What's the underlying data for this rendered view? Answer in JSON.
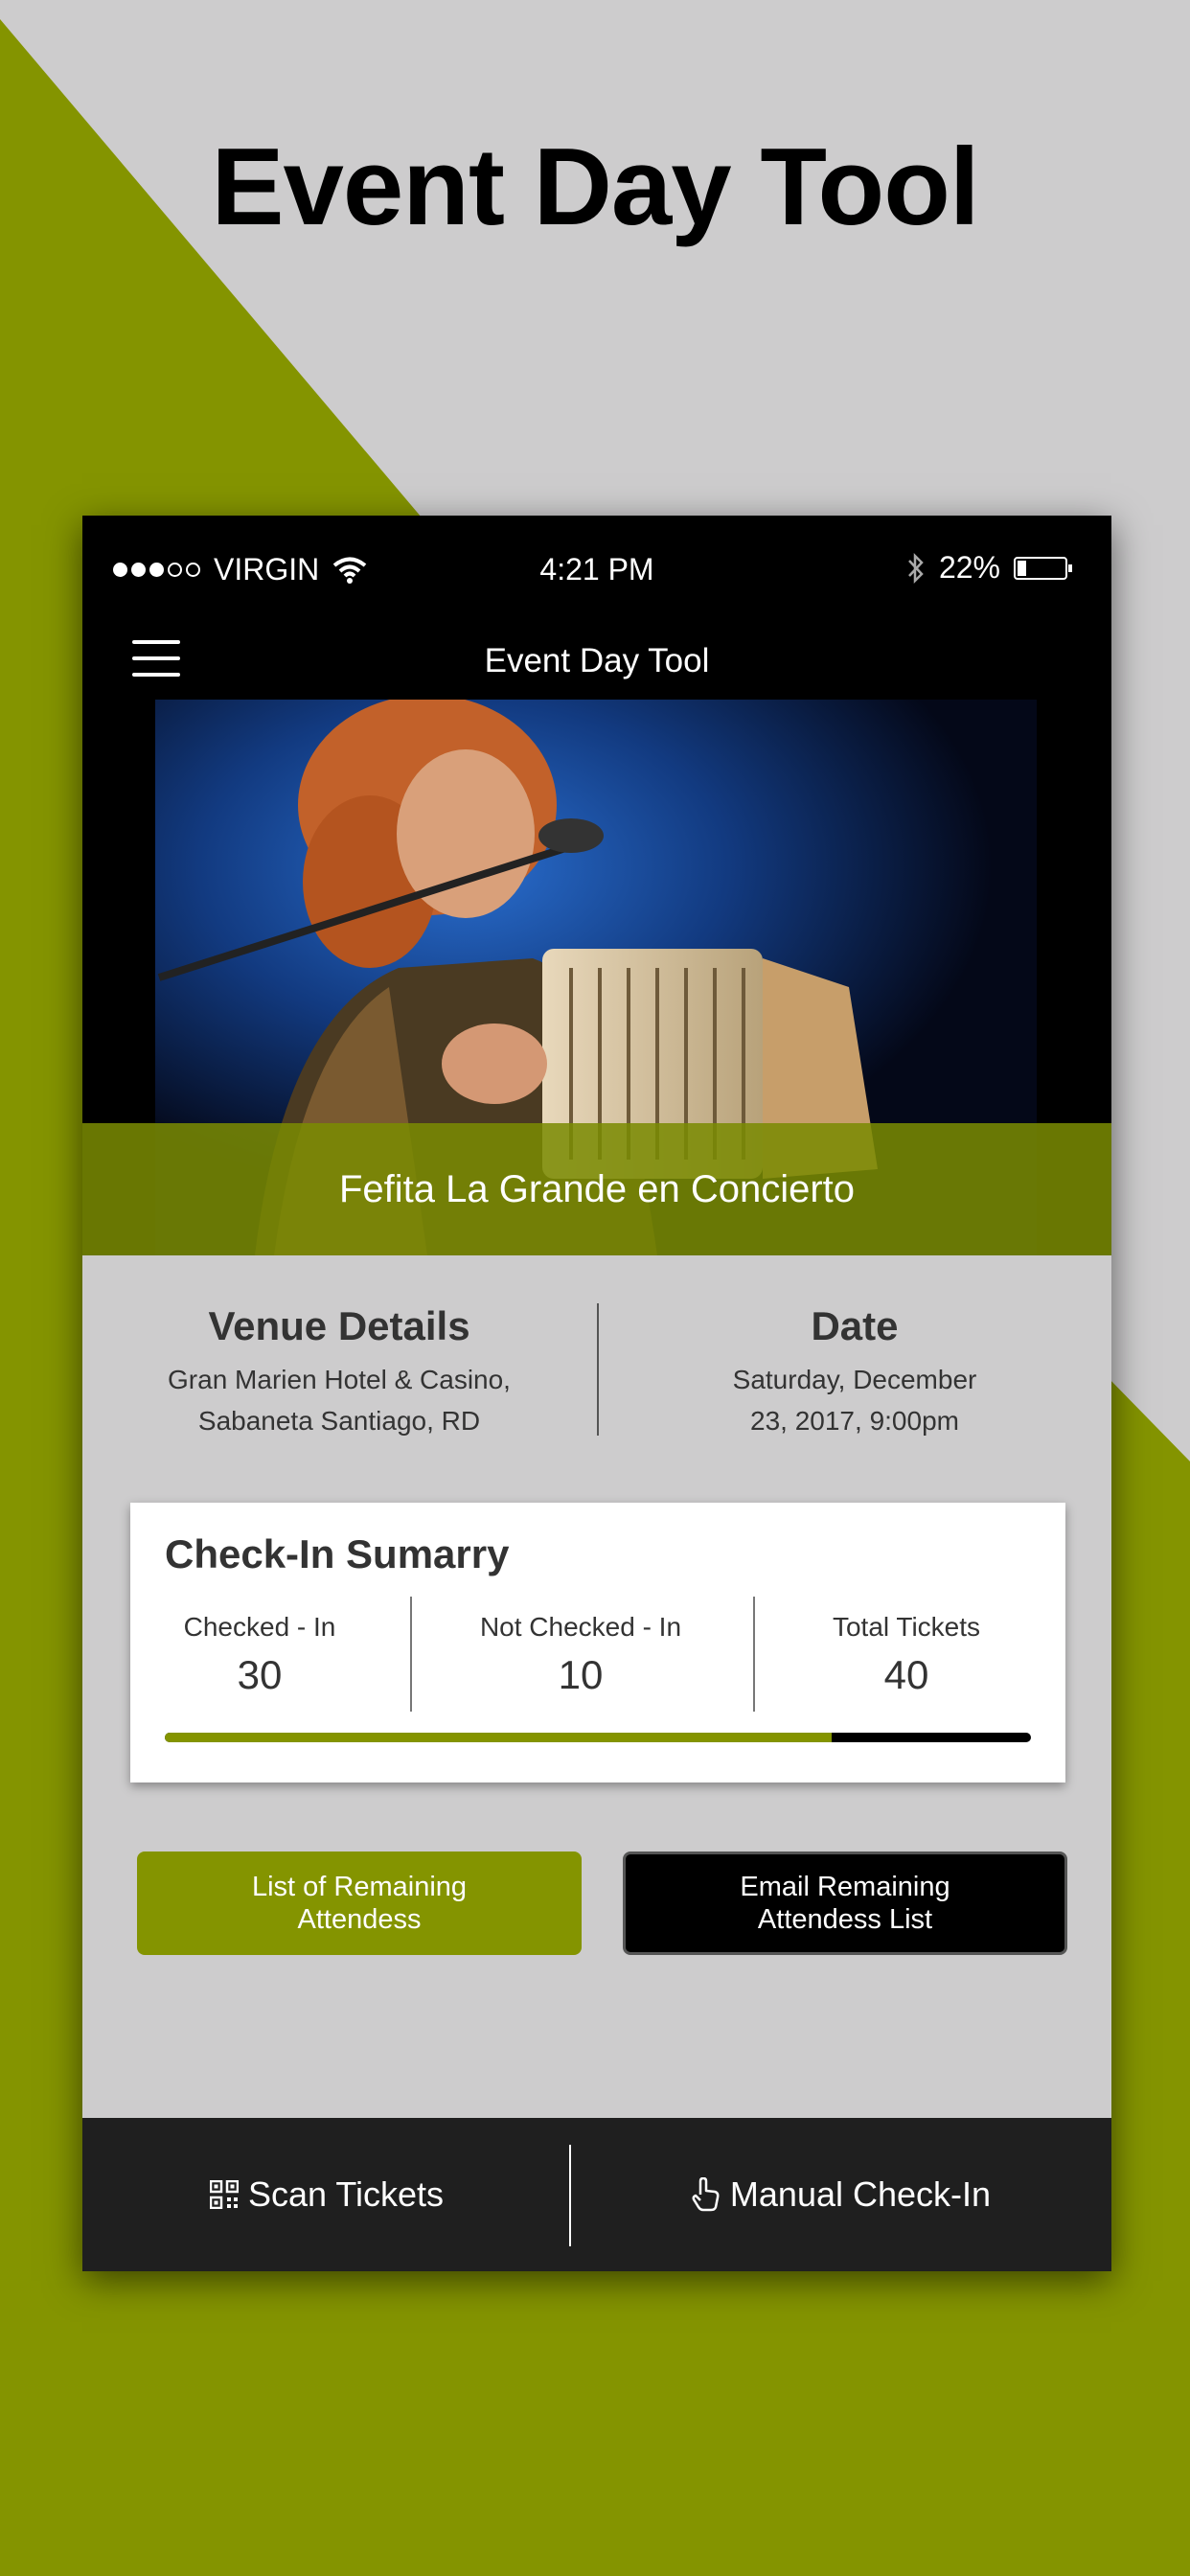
{
  "promo": {
    "title": "Event Day Tool",
    "accent_color": "#849400",
    "background_color": "#cdcccd"
  },
  "status_bar": {
    "carrier": "VIRGIN",
    "time": "4:21 PM",
    "battery": "22%",
    "battery_level": 0.22,
    "signal_bars": 3,
    "signal_max": 5
  },
  "nav": {
    "title": "Event Day Tool",
    "menu_icon": "hamburger-menu-icon"
  },
  "event": {
    "name": "Fefita La Grande en Concierto",
    "image": "accordion-singer-photo"
  },
  "venue": {
    "heading": "Venue Details",
    "line1": "Gran Marien Hotel & Casino,",
    "line2": "Sabaneta Santiago, RD"
  },
  "date": {
    "heading": "Date",
    "line1": "Saturday, December",
    "line2": "23, 2017, 9:00pm"
  },
  "summary": {
    "title": "Check-In Sumarry",
    "checked_in": {
      "label": "Checked - In",
      "value": "30"
    },
    "not_checked_in": {
      "label": "Not Checked - In",
      "value": "10"
    },
    "total": {
      "label": "Total Tickets",
      "value": "40"
    },
    "progress": 0.77
  },
  "buttons": {
    "remaining_list": "List of Remaining Attendess",
    "email_list": "Email Remaining Attendess List"
  },
  "bottom": {
    "scan": {
      "label": "Scan Tickets",
      "icon": "qr-code-icon"
    },
    "manual": {
      "label": "Manual Check-In",
      "icon": "hand-pointer-icon"
    }
  }
}
